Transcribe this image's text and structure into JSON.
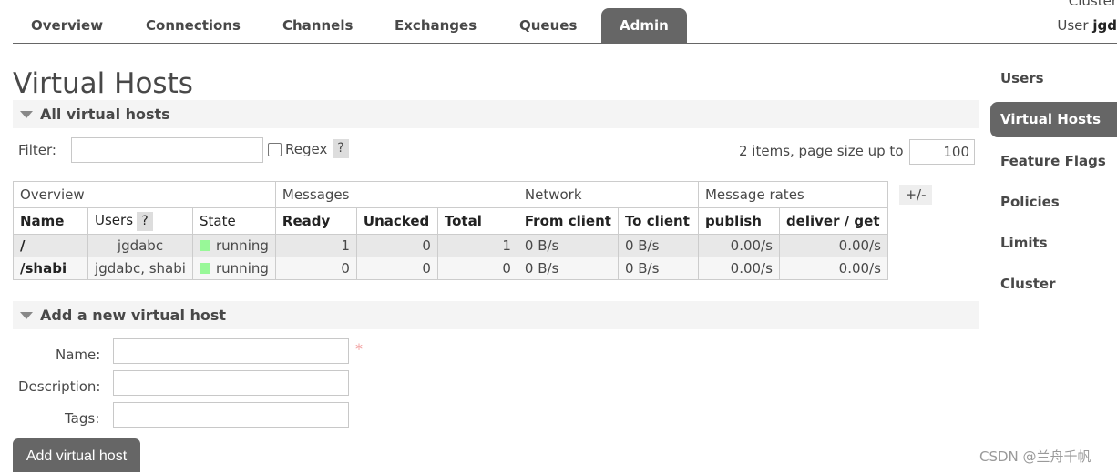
{
  "nav": {
    "tabs": [
      {
        "label": "Overview"
      },
      {
        "label": "Connections"
      },
      {
        "label": "Channels"
      },
      {
        "label": "Exchanges"
      },
      {
        "label": "Queues"
      },
      {
        "label": "Admin",
        "active": true
      }
    ],
    "cluster_label": "Cluster",
    "user_label": "User",
    "user_name": "jgd"
  },
  "page_title": "Virtual Hosts",
  "all_vhosts": {
    "section_title": "All virtual hosts",
    "filter_label": "Filter:",
    "filter_value": "",
    "regex_label": "Regex",
    "help_mark": "?",
    "items_text": "2 items, page size up to",
    "page_size": "100",
    "table": {
      "groups": [
        "Overview",
        "Messages",
        "Network",
        "Message rates"
      ],
      "columns": [
        "Name",
        "Users",
        "State",
        "Ready",
        "Unacked",
        "Total",
        "From client",
        "To client",
        "publish",
        "deliver / get"
      ],
      "rows": [
        {
          "name": "/",
          "users": "jgdabc",
          "state": "running",
          "ready": "1",
          "unacked": "0",
          "total": "1",
          "from_client": "0 B/s",
          "to_client": "0 B/s",
          "publish": "0.00/s",
          "deliver_get": "0.00/s"
        },
        {
          "name": "/shabi",
          "users": "jgdabc, shabi",
          "state": "running",
          "ready": "0",
          "unacked": "0",
          "total": "0",
          "from_client": "0 B/s",
          "to_client": "0 B/s",
          "publish": "0.00/s",
          "deliver_get": "0.00/s"
        }
      ]
    },
    "toggle_columns": "+/-"
  },
  "add_vhost": {
    "section_title": "Add a new virtual host",
    "name_label": "Name:",
    "description_label": "Description:",
    "tags_label": "Tags:",
    "required_mark": "*",
    "button_label": "Add virtual host"
  },
  "sidebar": {
    "items": [
      {
        "label": "Users"
      },
      {
        "label": "Virtual Hosts",
        "active": true
      },
      {
        "label": "Feature Flags"
      },
      {
        "label": "Policies"
      },
      {
        "label": "Limits"
      },
      {
        "label": "Cluster"
      }
    ]
  },
  "watermark": "CSDN @兰舟千帆",
  "colors": {
    "accent": "#666666",
    "running_indicator": "#98f898",
    "required": "#f29b9b"
  }
}
